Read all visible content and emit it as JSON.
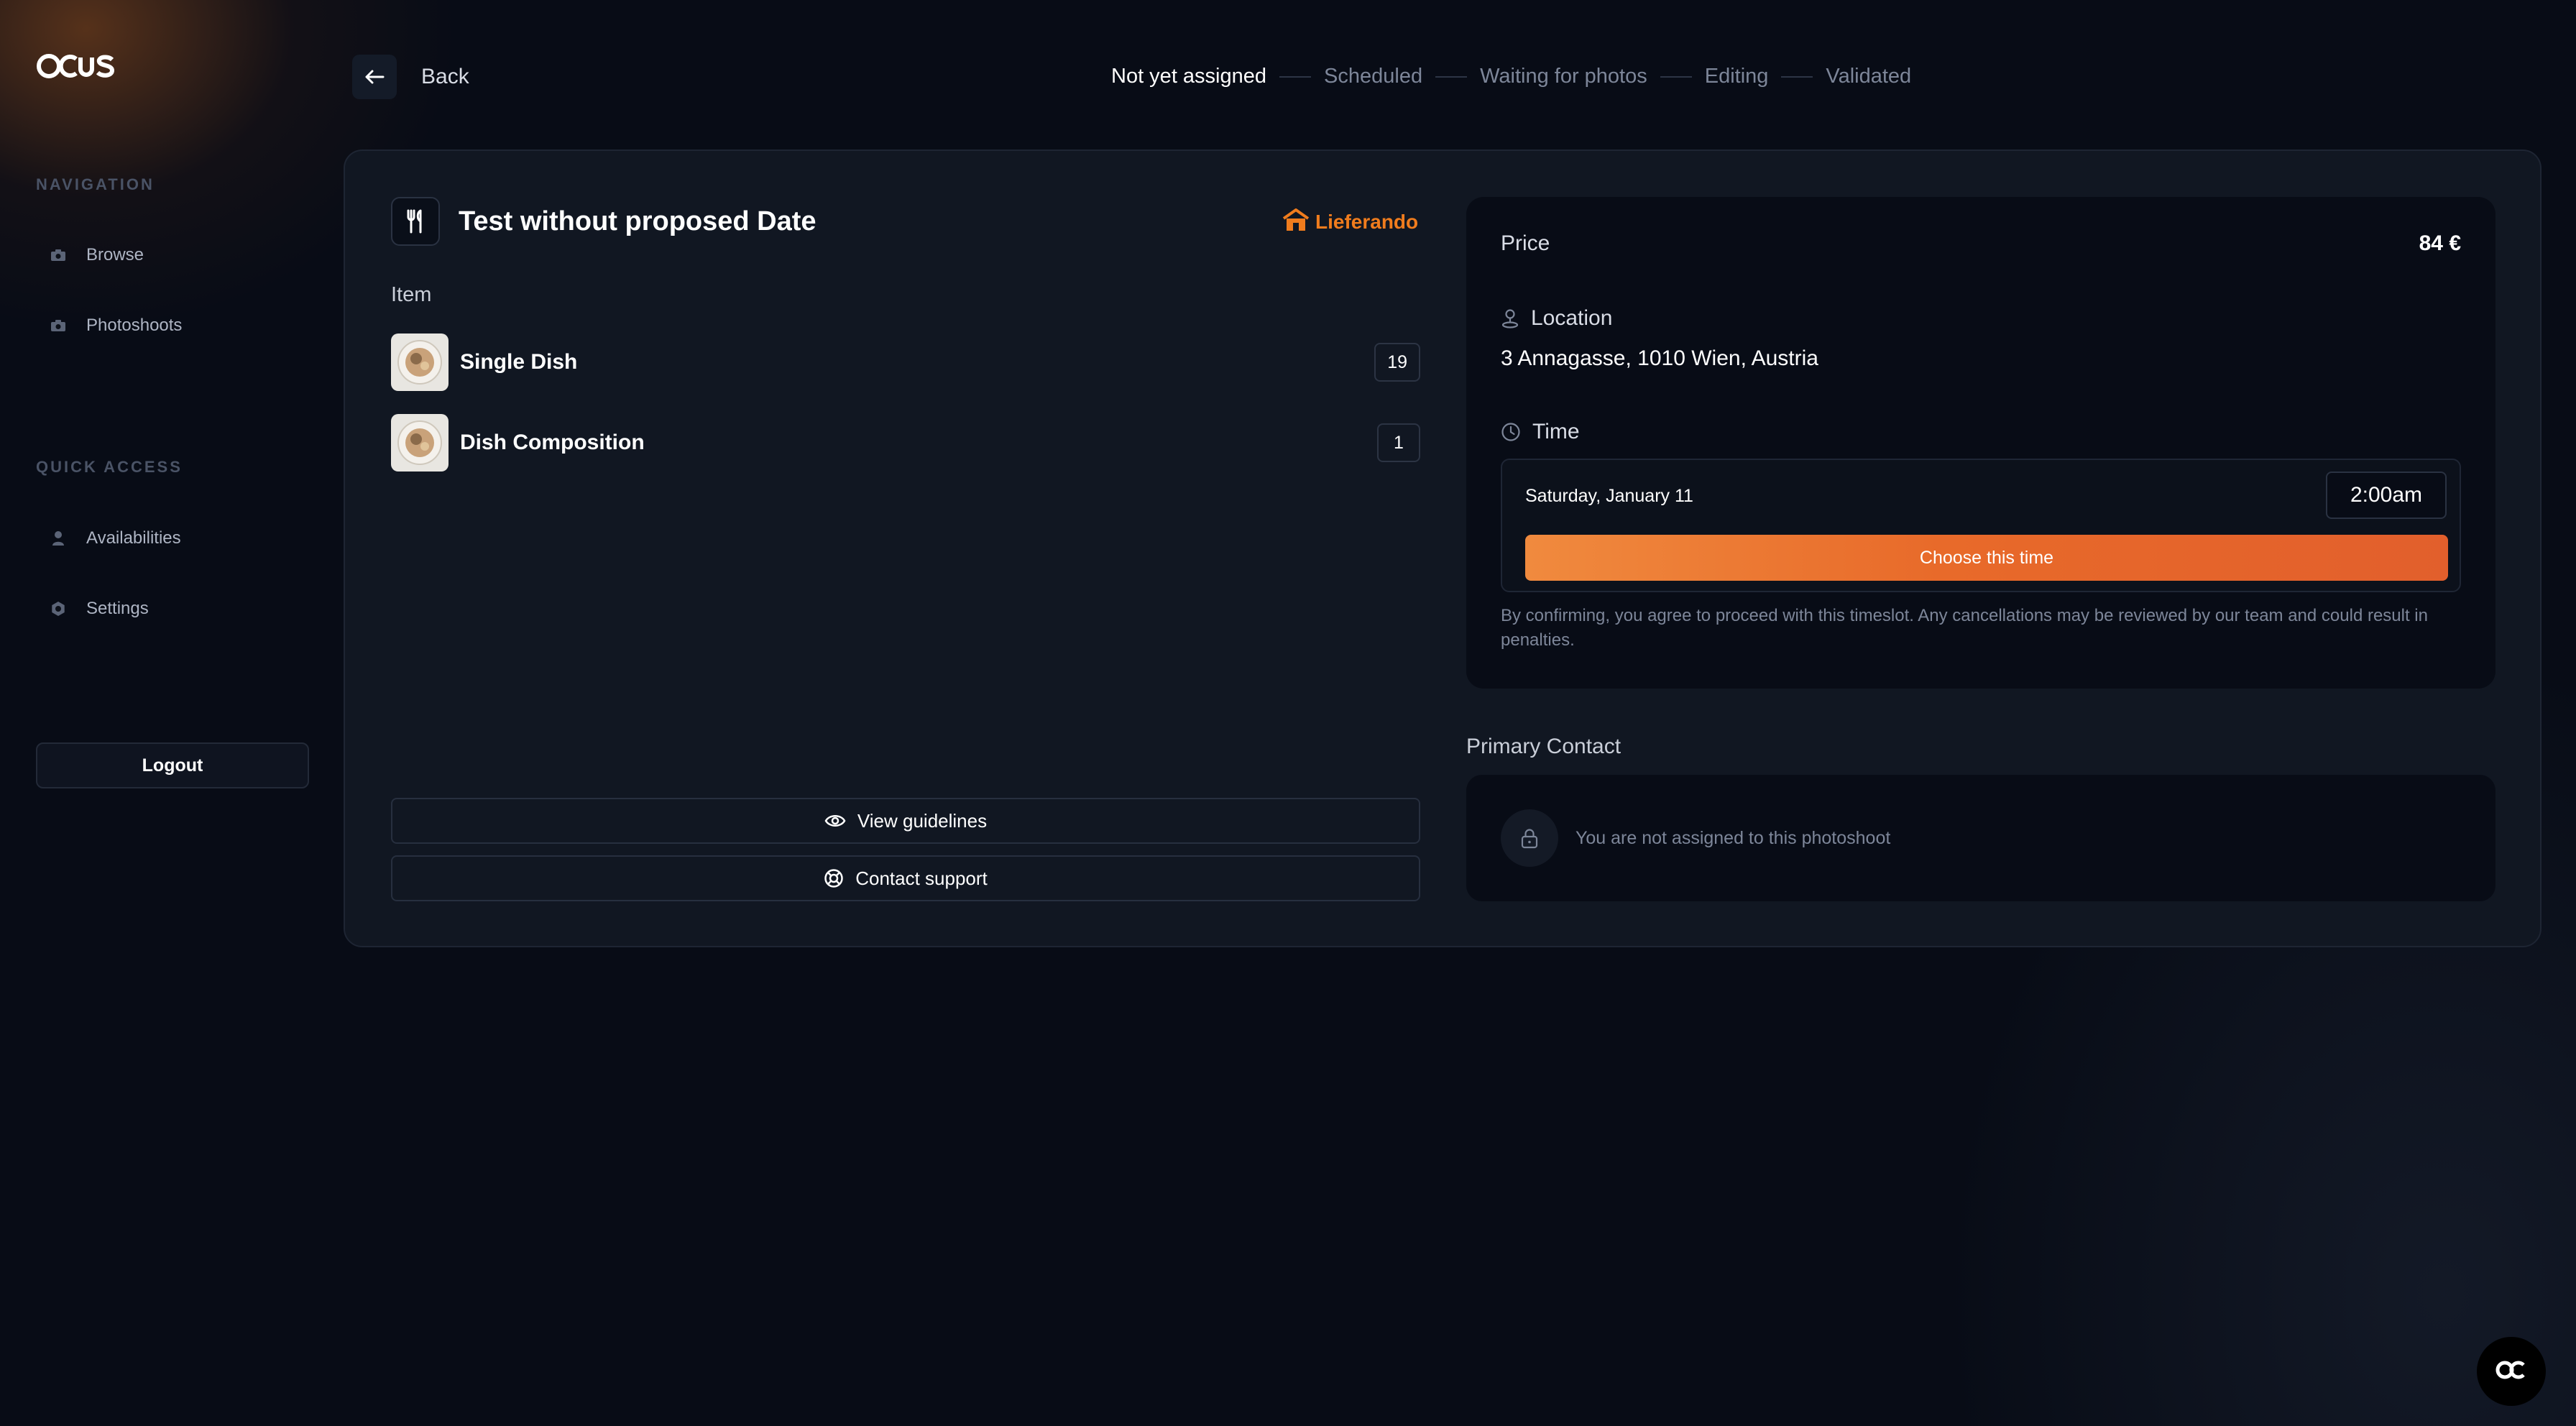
{
  "app": {
    "logo_text": "OCUS"
  },
  "sidebar": {
    "navigation_label": "NAVIGATION",
    "navigation_items": [
      {
        "label": "Browse",
        "icon": "camera-icon"
      },
      {
        "label": "Photoshoots",
        "icon": "camera-icon"
      }
    ],
    "quick_access_label": "QUICK ACCESS",
    "quick_access_items": [
      {
        "label": "Availabilities",
        "icon": "person-icon"
      },
      {
        "label": "Settings",
        "icon": "gear-icon"
      }
    ],
    "logout_label": "Logout"
  },
  "topbar": {
    "back_label": "Back",
    "steps": [
      "Not yet assigned",
      "Scheduled",
      "Waiting for photos",
      "Editing",
      "Validated"
    ],
    "active_step": "Not yet assigned"
  },
  "photoshoot": {
    "title": "Test without proposed Date",
    "brand": "Lieferando",
    "item_label": "Item",
    "items": [
      {
        "name": "Single Dish",
        "count": "19"
      },
      {
        "name": "Dish Composition",
        "count": "1"
      }
    ],
    "view_guidelines_label": "View guidelines",
    "contact_support_label": "Contact support"
  },
  "details": {
    "price_label": "Price",
    "price_value": "84 €",
    "location_label": "Location",
    "location_value": "3 Annagasse, 1010 Wien, Austria",
    "time_label": "Time",
    "time_date": "Saturday, January 11",
    "time_value": "2:00am",
    "choose_label": "Choose this time",
    "disclaimer": "By confirming, you agree to proceed with this timeslot. Any cancellations may be reviewed by our team and could result in penalties."
  },
  "contact": {
    "title": "Primary Contact",
    "message": "You are not assigned to this photoshoot"
  },
  "colors": {
    "accent_orange": "#e86a2a",
    "brand_orange": "#f07c1d",
    "background": "#080c16",
    "card": "#111722"
  }
}
